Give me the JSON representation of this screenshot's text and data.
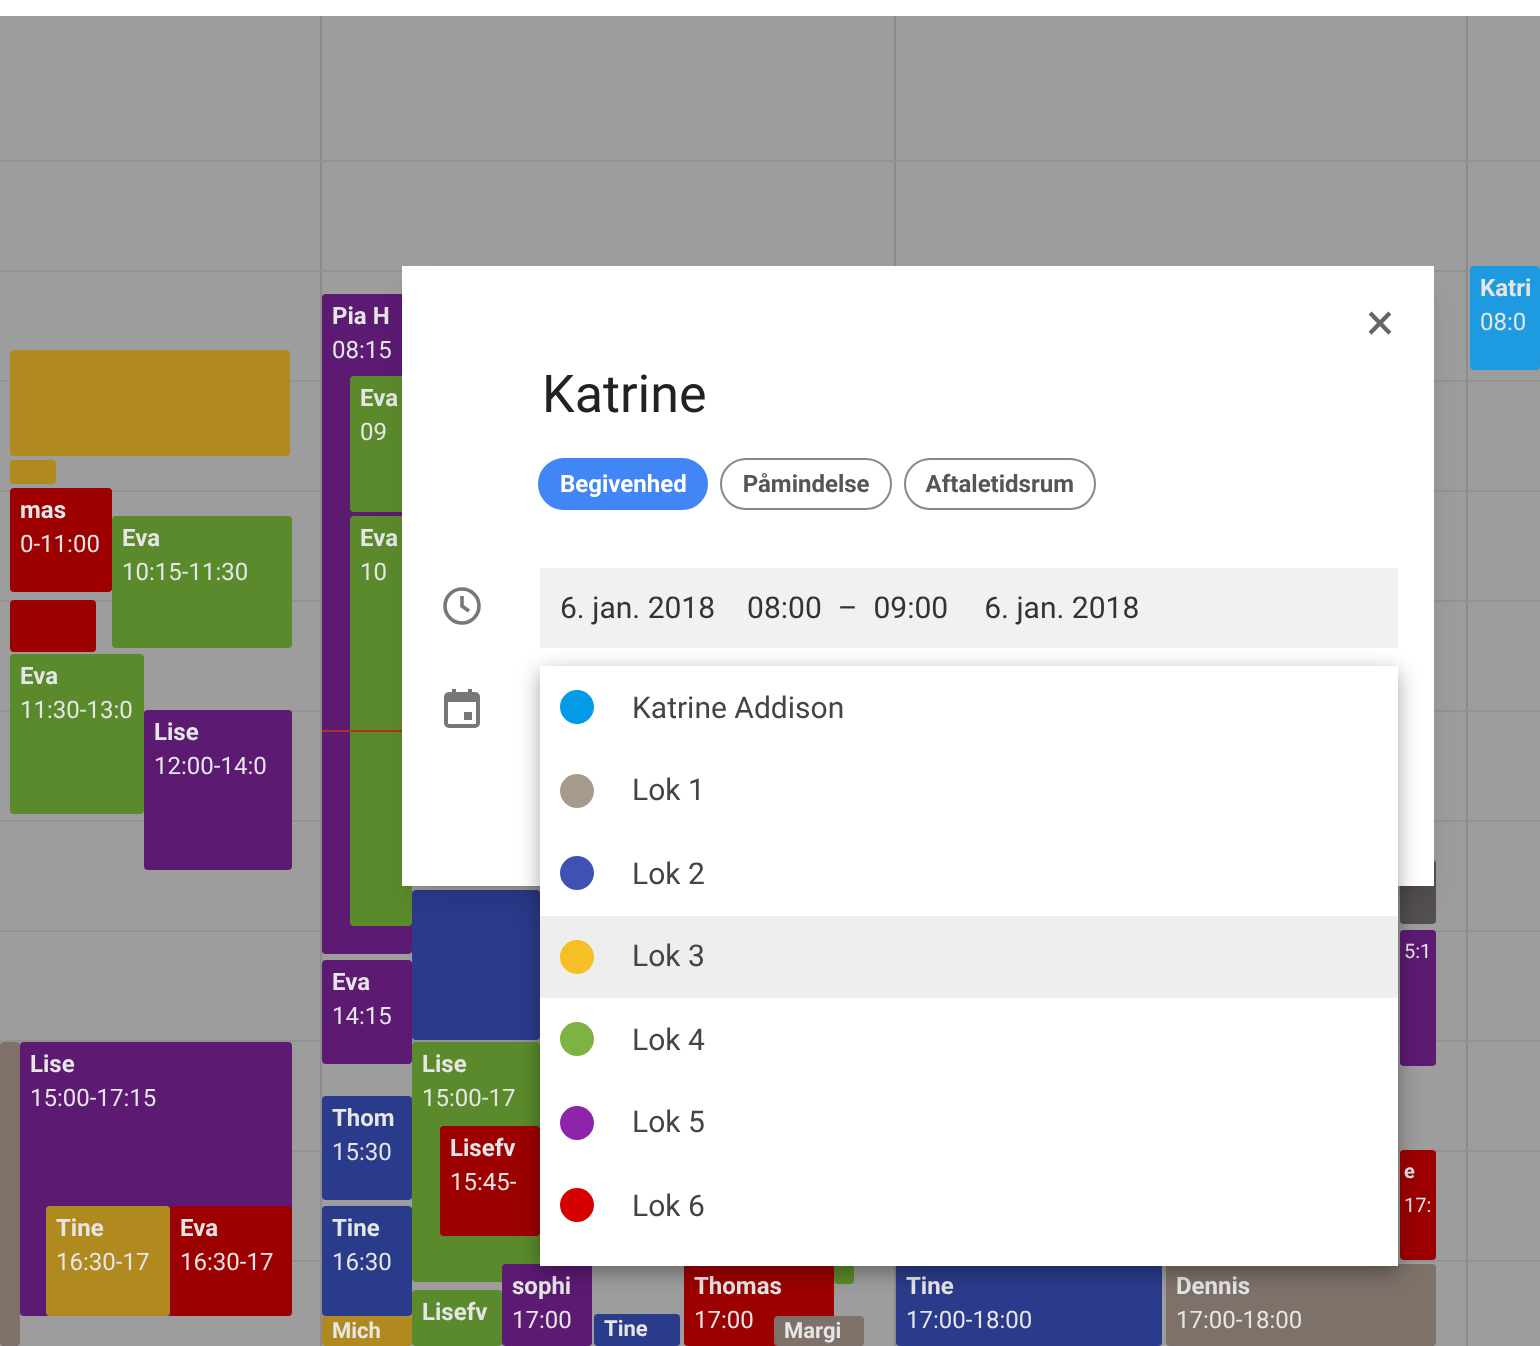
{
  "events": [
    {
      "color": "#b0891f"
    },
    {
      "color": "#b0891f"
    },
    {
      "title": "mas",
      "time": "0-11:00",
      "color": "#9c0000"
    },
    {
      "color": "#9c0000"
    },
    {
      "title": "Eva",
      "time": "10:15-11:30",
      "color": "#5b8a2c"
    },
    {
      "title": "Eva",
      "time": "11:30-13:0",
      "color": "#5b8a2c"
    },
    {
      "title": "Lise",
      "time": "12:00-14:0",
      "color": "#5c1a73"
    },
    {
      "title": "Pia H",
      "time": "08:15",
      "color": "#5c1a73"
    },
    {
      "title": "Eva",
      "time": "09",
      "color": "#5b8a2c"
    },
    {
      "title": "Eva",
      "time": "10",
      "color": "#5b8a2c"
    },
    {
      "title": "Eva",
      "time": "14:15",
      "color": "#5c1a73"
    },
    {
      "color": "#2b3b8c"
    },
    {
      "color": "#7d716a"
    },
    {
      "title": "Lise",
      "time": "15:00-17:15",
      "color": "#5c1a73"
    },
    {
      "title": "Tine",
      "time": "16:30-17",
      "color": "#b0891f"
    },
    {
      "title": "Eva",
      "time": "16:30-17",
      "color": "#9c0000"
    },
    {
      "title": "Thom",
      "time": "15:30",
      "color": "#2b3b8c"
    },
    {
      "title": "Tine",
      "time": "16:30",
      "color": "#2b3b8c"
    },
    {
      "title": "Mich",
      "color": "#b0891f"
    },
    {
      "title": "Lise",
      "time": "15:00-17",
      "color": "#5b8a2c"
    },
    {
      "title": "Lisefv",
      "time": "15:45-",
      "color": "#9c0000"
    },
    {
      "title": "Lisefv",
      "color": "#5b8a2c"
    },
    {
      "title": "sophi",
      "time": "17:00",
      "color": "#5c1a73"
    },
    {
      "title": "Tine",
      "color": "#2b3b8c"
    },
    {
      "title": "Thomas",
      "time": "17:00",
      "color": "#9c0000"
    },
    {
      "title": "Margi",
      "color": "#7d716a"
    },
    {
      "color": "#5b8a2c"
    },
    {
      "title": "Tine",
      "time": "17:00-18:00",
      "color": "#2b3b8c"
    },
    {
      "title": "Dennis",
      "time": "17:00-18:00",
      "color": "#7d716a"
    },
    {
      "color": "#555050"
    },
    {
      "time": "5:1",
      "color": "#5c1a73"
    },
    {
      "title": "e",
      "time": "17:",
      "color": "#9c0000"
    },
    {
      "title": "Katri",
      "time": "08:0",
      "color": "#1e9be0"
    }
  ],
  "dialog": {
    "title": "Katrine",
    "close": "×",
    "chips": [
      {
        "label": "Begivenhed",
        "selected": true
      },
      {
        "label": "Påmindelse",
        "selected": false
      },
      {
        "label": "Aftaletidsrum",
        "selected": false
      }
    ],
    "start_date": "6. jan. 2018",
    "start_time": "08:00",
    "separator": "–",
    "end_time": "09:00",
    "end_date": "6. jan. 2018",
    "calendars": [
      {
        "label": "Katrine Addison",
        "color": "#039be5",
        "selected": false
      },
      {
        "label": "Lok 1",
        "color": "#a79b8e",
        "selected": false
      },
      {
        "label": "Lok 2",
        "color": "#3f51b5",
        "selected": false
      },
      {
        "label": "Lok 3",
        "color": "#f6bf26",
        "selected": true
      },
      {
        "label": "Lok 4",
        "color": "#7cb342",
        "selected": false
      },
      {
        "label": "Lok 5",
        "color": "#8e24aa",
        "selected": false
      },
      {
        "label": "Lok 6",
        "color": "#d50000",
        "selected": false
      }
    ]
  }
}
